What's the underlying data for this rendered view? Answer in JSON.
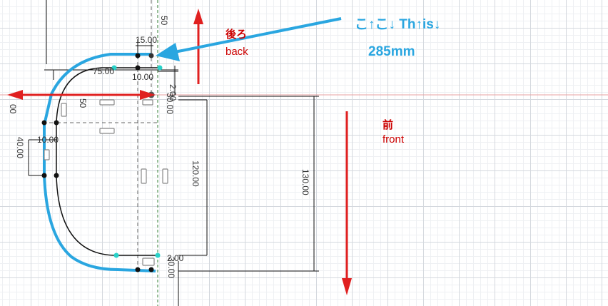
{
  "annotations": {
    "back_jp": "後ろ",
    "back_en": "back",
    "front_jp": "前",
    "front_en": "front",
    "callout_text": "こ↑こ↓ Th↑is↓",
    "callout_value": "285mm"
  },
  "dimensions": {
    "d15": "15.00",
    "d75": "75.00",
    "d10_top": "10.00",
    "d2_top": "2.00",
    "d50_a": "50",
    "d50_b": "50",
    "d00": "00",
    "d10_left": "10.00",
    "d40": "40.00",
    "d120": "120.00",
    "d130": "130.00",
    "d2_bottom": "2.00",
    "d30_bottom": "30.00",
    "d30_right": "30.00"
  },
  "colors": {
    "annotation_red": "#cc0000",
    "callout_blue": "#2aa6e0",
    "axis_red": "#e25b5b",
    "sketch_green": "#2f7d32",
    "point_cyan": "#2ad2c9"
  }
}
